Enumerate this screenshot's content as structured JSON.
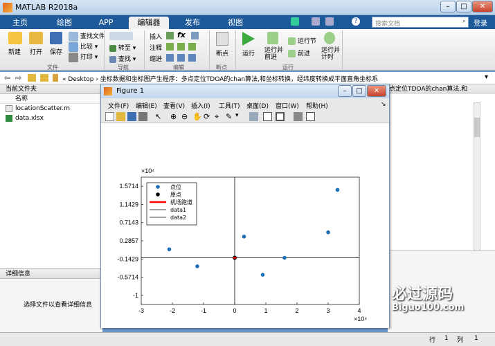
{
  "app": {
    "title": "MATLAB R2018a"
  },
  "ribbon_tabs": [
    "主页",
    "绘图",
    "APP",
    "编辑器",
    "发布",
    "视图"
  ],
  "search": {
    "placeholder": "搜索文档"
  },
  "login": "登录",
  "ribbon": {
    "file": {
      "new": "新建",
      "open": "打开",
      "save": "保存",
      "find_files": "查找文件",
      "compare": "比较",
      "print": "打印",
      "group": "文件"
    },
    "nav": {
      "goto": "转至",
      "find": "查找",
      "group": "导航"
    },
    "edit": {
      "insert": "插入",
      "comment": "注释",
      "indent": "缩进",
      "fx": "fx",
      "group": "编辑"
    },
    "breakpoints": {
      "label": "断点",
      "group": "断点"
    },
    "run": {
      "run": "运行",
      "run_advance": "运行并\n前进",
      "run_section": "运行节",
      "advance": "前进",
      "run_time": "运行并\n计时",
      "group": "运行"
    }
  },
  "address": {
    "path": "« Desktop › 坐标数据和坐标图产生程序：多点定位TDOA的chan算法,和坐标转换，经纬度转换成平面直角坐标系",
    "behind": "点定位TDOA的chan算法,和"
  },
  "file_panel": {
    "title": "当前文件夹",
    "col_name": "名称",
    "files": [
      {
        "name": "locationScatter.m",
        "icon": "m-file-icon"
      },
      {
        "name": "data.xlsx",
        "icon": "excel-file-icon"
      }
    ]
  },
  "details_panel": {
    "title": "详细信息",
    "message": "选择文件以查看详细信息"
  },
  "status": {
    "row_label": "行",
    "row": "1",
    "col_label": "列",
    "col": "1"
  },
  "figure": {
    "title": "Figure 1",
    "menu": [
      "文件(F)",
      "编辑(E)",
      "查看(V)",
      "插入(I)",
      "工具(T)",
      "桌面(D)",
      "窗口(W)",
      "帮助(H)"
    ],
    "axes": {
      "x_ticks": [
        "-3",
        "-2",
        "-1",
        "0",
        "1",
        "2",
        "3",
        "4"
      ],
      "y_ticks": [
        "1.5714",
        "1.1429",
        "0.7143",
        "0.2857",
        "-0.1429",
        "-0.5714",
        "-1"
      ],
      "x_exp": "×10⁴",
      "y_exp": "×10⁴"
    },
    "legend": [
      {
        "label": "点位",
        "color": "#1f6fb7",
        "kind": "dot"
      },
      {
        "label": "原点",
        "color": "#000000",
        "kind": "dot"
      },
      {
        "label": "机场跑道",
        "color": "#ff0000",
        "kind": "thick-line"
      },
      {
        "label": "data1",
        "color": "#000000",
        "kind": "line"
      },
      {
        "label": "data2",
        "color": "#000000",
        "kind": "line"
      }
    ]
  },
  "chart_data": {
    "type": "scatter",
    "xlim": [
      -3,
      4
    ],
    "ylim": [
      -1,
      2
    ],
    "x_scale": "×10⁴",
    "y_scale": "×10⁴",
    "series": [
      {
        "name": "点位",
        "color": "#1f6fb7",
        "points": [
          [
            -2.1,
            0.3
          ],
          [
            -1.2,
            -0.1
          ],
          [
            0.3,
            0.6
          ],
          [
            0.9,
            -0.3
          ],
          [
            1.6,
            0.1
          ],
          [
            3.0,
            0.7
          ],
          [
            3.3,
            1.7
          ]
        ]
      },
      {
        "name": "原点",
        "color": "#000000",
        "points": [
          [
            0,
            0.1
          ]
        ]
      },
      {
        "name": "机场跑道",
        "color": "#ff0000",
        "points": [
          [
            -0.05,
            0.1
          ],
          [
            0.05,
            0.1
          ]
        ]
      }
    ],
    "reference_lines": {
      "data1": "y-axis at x=0",
      "data2": "x-axis at y=0.1"
    }
  },
  "watermark": {
    "text1": "必过源码",
    "text2": "Biguo100.com"
  }
}
